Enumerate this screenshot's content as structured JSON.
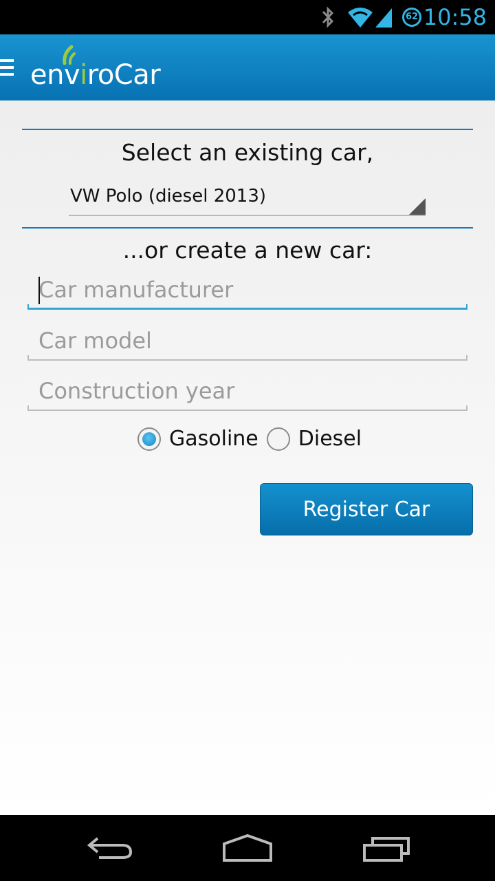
{
  "status_bar": {
    "time": "10:58",
    "battery_level": "62",
    "icons": [
      "bluetooth-icon",
      "wifi-icon",
      "signal-icon",
      "battery-icon"
    ],
    "accent_color": "#33b5e5"
  },
  "action_bar": {
    "logo_text_before": "env",
    "logo_text_i": "i",
    "logo_text_after": "roCar",
    "menu_icon": "menu-icon",
    "background_color": "#0a7dc0"
  },
  "form": {
    "select_label": "Select an existing car,",
    "selected_car": "VW Polo (diesel 2013)",
    "create_label": "...or create a new car:",
    "manufacturer_placeholder": "Car manufacturer",
    "model_placeholder": "Car model",
    "year_placeholder": "Construction year",
    "fuel_options": [
      "Gasoline",
      "Diesel"
    ],
    "selected_fuel": "Gasoline",
    "register_label": "Register Car"
  },
  "nav_bar": {
    "icons": [
      "back-icon",
      "home-icon",
      "recent-apps-icon"
    ]
  }
}
